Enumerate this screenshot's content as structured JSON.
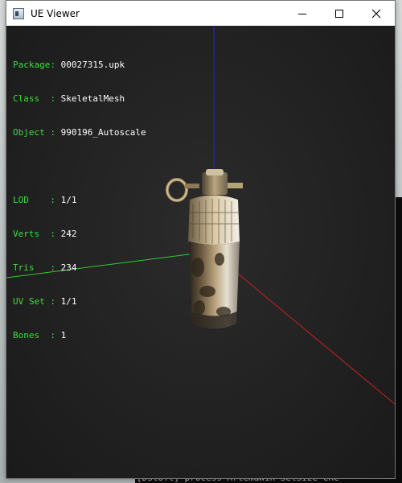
{
  "window": {
    "title": "UE Viewer"
  },
  "info": {
    "package_label": "Package: ",
    "package_value": "00027315.upk",
    "class_label": "Class  : ",
    "class_value": "SkeletalMesh",
    "object_label": "Object : ",
    "object_value": "990196_Autoscale",
    "lod_label": "LOD    : ",
    "lod_value": "1/1",
    "verts_label": "Verts  : ",
    "verts_value": "242",
    "tris_label": "Tris   : ",
    "tris_value": "234",
    "uvset_label": "UV Set : ",
    "uvset_value": "1/1",
    "bones_label": "Bones  : ",
    "bones_value": "1"
  },
  "background_console": {
    "bottom_line": "[DStoTt] process  ArtemaWin SetSize  CRC"
  },
  "colors": {
    "label_green": "#3ddc3d",
    "axis_x": "#cc1f1f",
    "axis_y": "#2ecc2e",
    "axis_z": "#2222dd",
    "viewport_bg": "#222222"
  }
}
